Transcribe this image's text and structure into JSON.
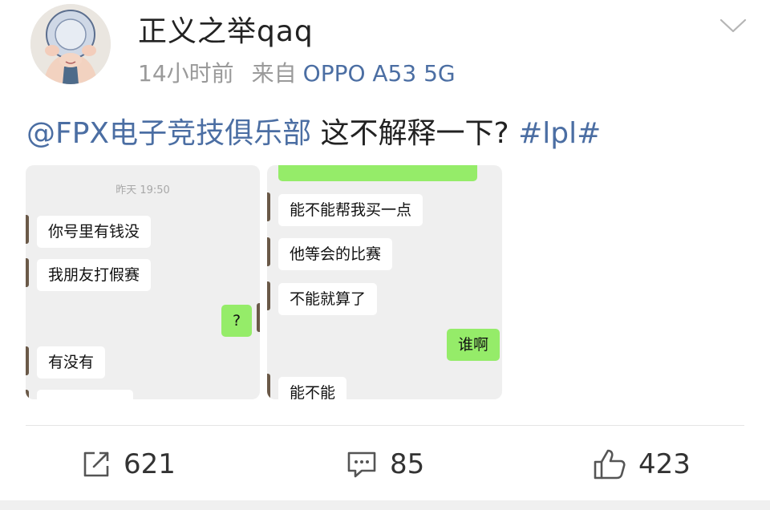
{
  "post": {
    "username": "正义之举qaq",
    "time": "14小时前",
    "source_prefix": "来自",
    "device": "OPPO A53 5G",
    "mention": "@FPX电子竞技俱乐部",
    "body_text": " 这不解释一下? ",
    "hashtag": "#lpl#"
  },
  "images": {
    "left": {
      "timestamp": "昨天 19:50",
      "messages": [
        "你号里有钱没",
        "我朋友打假赛",
        "?",
        "有没有"
      ]
    },
    "right": {
      "messages": [
        "能不能帮我买一点",
        "他等会的比赛",
        "不能就算了",
        "谁啊",
        "能不能"
      ]
    }
  },
  "actions": {
    "share_count": "621",
    "comment_count": "85",
    "like_count": "423"
  },
  "colors": {
    "link": "#4b6ea3",
    "bubble_self": "#95ec69",
    "chat_bg": "#efefef"
  },
  "icons": [
    "share-icon",
    "comment-icon",
    "thumbs-up-icon",
    "chevron-down-icon"
  ]
}
